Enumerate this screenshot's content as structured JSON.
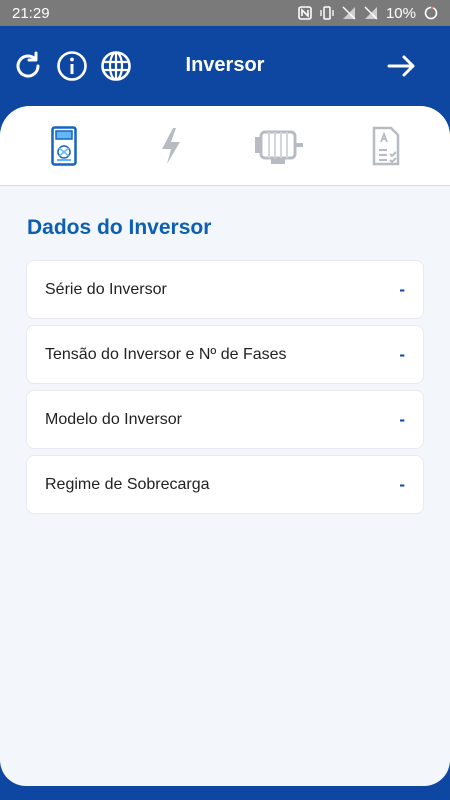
{
  "status_bar": {
    "time": "21:29",
    "battery": "10%",
    "icons": [
      "nfc-icon",
      "vibrate-icon",
      "no-signal-icon",
      "no-signal-icon",
      "battery-ring-icon"
    ]
  },
  "app_bar": {
    "title": "Inversor",
    "icons": [
      "refresh-icon",
      "info-icon",
      "globe-icon",
      "arrow-right-icon"
    ],
    "color": "#0d47a1"
  },
  "tabs": [
    {
      "name": "inverter",
      "icon": "inverter-icon",
      "active": true
    },
    {
      "name": "power",
      "icon": "lightning-icon",
      "active": false
    },
    {
      "name": "motor",
      "icon": "motor-icon",
      "active": false
    },
    {
      "name": "checklist",
      "icon": "document-checklist-icon",
      "active": false
    }
  ],
  "section": {
    "title": "Dados do Inversor"
  },
  "items": [
    {
      "label": "Série do Inversor",
      "value": "-"
    },
    {
      "label": "Tensão do Inversor e Nº de Fases",
      "value": "-"
    },
    {
      "label": "Modelo do Inversor",
      "value": "-"
    },
    {
      "label": "Regime de Sobrecarga",
      "value": "-"
    }
  ],
  "colors": {
    "primary": "#0d47a1",
    "accent_text": "#0d5fb4",
    "background": "#f3f6fb",
    "inactive_icon": "#b8bcc2"
  }
}
